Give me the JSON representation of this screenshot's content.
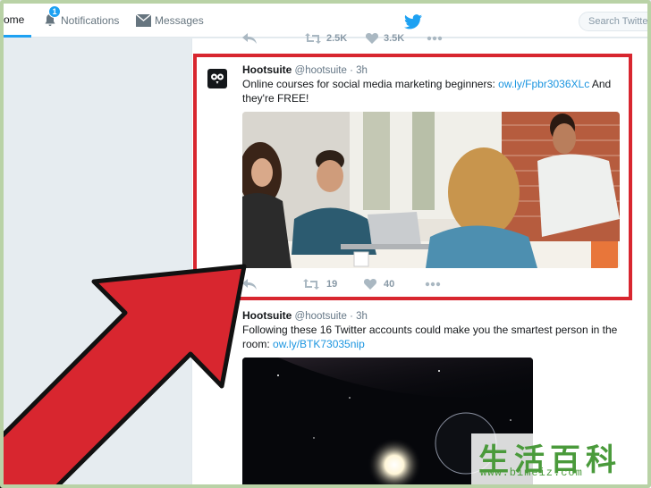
{
  "nav": {
    "home_label": "ome",
    "notifications_label": "Notifications",
    "notifications_badge": "1",
    "messages_label": "Messages",
    "search_placeholder": "Search Twitter"
  },
  "prev_tweet_actions": {
    "retweets": "2.5K",
    "likes": "3.5K"
  },
  "tweets": [
    {
      "name": "Hootsuite",
      "handle": "@hootsuite",
      "sep": "·",
      "time": "3h",
      "text_before": "Online courses for social media marketing beginners: ",
      "link": "ow.ly/Fpbr3036XLc",
      "text_after": " And they're FREE!",
      "retweets": "19",
      "likes": "40"
    },
    {
      "name": "Hootsuite",
      "handle": "@hootsuite",
      "sep": "·",
      "time": "3h",
      "text_before": "Following these 16 Twitter accounts could make you the smartest person in the room: ",
      "link": "ow.ly/BTK73035nip",
      "text_after": ""
    }
  ],
  "watermark": {
    "chinese": "生活百科",
    "url": "www.bimeiz.com"
  },
  "colors": {
    "accent": "#1da1f2",
    "highlight": "#d8262f",
    "arrow": "#d8262f",
    "watermark": "#4a9a3b"
  }
}
